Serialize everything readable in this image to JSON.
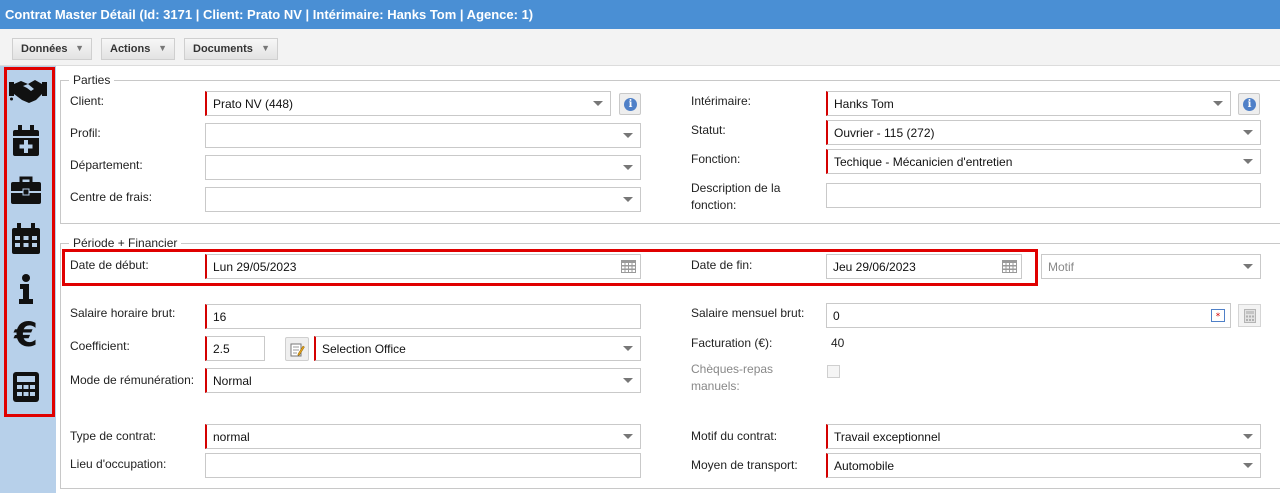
{
  "window": {
    "title": "Contrat Master Détail (Id: 3171 | Client: Prato NV | Intérimaire: Hanks Tom | Agence: 1)"
  },
  "menu": {
    "donnees": "Données",
    "actions": "Actions",
    "documents": "Documents"
  },
  "sidebar": {
    "icons": [
      "handshake-icon",
      "calendar-plus-icon",
      "briefcase-icon",
      "calendar-icon",
      "info-icon",
      "euro-icon",
      "calculator-icon"
    ],
    "euro_symbol": "€",
    "info_symbol": "i"
  },
  "parties": {
    "legend": "Parties",
    "client": {
      "label": "Client:",
      "value": "Prato NV (448)"
    },
    "profil": {
      "label": "Profil:",
      "value": ""
    },
    "departement": {
      "label": "Département:",
      "value": ""
    },
    "centre_frais": {
      "label": "Centre de frais:",
      "value": ""
    },
    "interimaire": {
      "label": "Intérimaire:",
      "value": "Hanks Tom"
    },
    "statut": {
      "label": "Statut:",
      "value": "Ouvrier - 115 (272)"
    },
    "fonction": {
      "label": "Fonction:",
      "value": "Techique - Mécanicien d'entretien"
    },
    "description_fonction": {
      "label_line1": "Description de la",
      "label_line2": "fonction:",
      "value": ""
    },
    "info_glyph": "i"
  },
  "periode": {
    "legend": "Période + Financier",
    "date_debut": {
      "label": "Date de début:",
      "value": "Lun 29/05/2023"
    },
    "date_fin": {
      "label": "Date de fin:",
      "value": "Jeu 29/06/2023"
    },
    "motif": {
      "placeholder": "Motif"
    },
    "salaire_horaire": {
      "label": "Salaire horaire brut:",
      "value": "16"
    },
    "coefficient": {
      "label": "Coefficient:",
      "value": "2.5",
      "office": "Selection Office"
    },
    "mode_remuneration": {
      "label": "Mode de rémunération:",
      "value": "Normal"
    },
    "salaire_mensuel": {
      "label": "Salaire mensuel brut:",
      "value": "0"
    },
    "facturation": {
      "label": "Facturation (€):",
      "value": "40"
    },
    "cheques_repas": {
      "label_line1": "Chèques-repas",
      "label_line2": "manuels:",
      "checked": false
    },
    "type_contrat": {
      "label": "Type de contrat:",
      "value": "normal"
    },
    "lieu_occupation": {
      "label": "Lieu d'occupation:",
      "value": ""
    },
    "motif_contrat": {
      "label": "Motif du contrat:",
      "value": "Travail exceptionnel"
    },
    "moyen_transport": {
      "label": "Moyen de transport:",
      "value": "Automobile"
    }
  },
  "colors": {
    "titlebar": "#4a8fd4",
    "sidebar": "#b7d0ea",
    "highlight": "#e00000",
    "required": "#d40000"
  }
}
